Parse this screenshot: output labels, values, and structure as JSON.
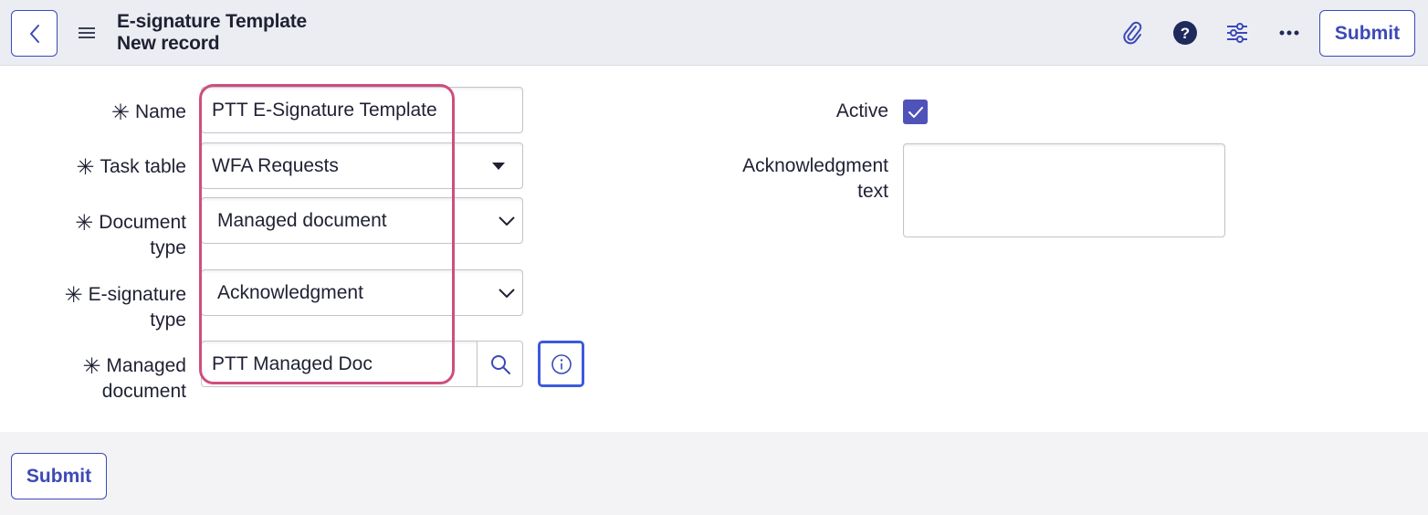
{
  "header": {
    "title_line1": "E-signature Template",
    "title_line2": "New record",
    "submit_label": "Submit",
    "icons": [
      "chevron-left-icon",
      "hamburger-menu-icon",
      "paperclip-icon",
      "help-icon",
      "sliders-icon",
      "more-options-icon"
    ]
  },
  "form": {
    "name": {
      "label": "Name",
      "value": "PTT E-Signature Template",
      "required": true
    },
    "task_table": {
      "label": "Task table",
      "value": "WFA Requests",
      "required": true
    },
    "document_type": {
      "label_line1": "Document",
      "label_line2": "type",
      "value": "Managed document",
      "required": true
    },
    "esignature_type": {
      "label_line1": "E-signature",
      "label_line2": "type",
      "value": "Acknowledgment",
      "required": true
    },
    "managed_document": {
      "label_line1": "Managed",
      "label_line2": "document",
      "value": "PTT Managed Doc",
      "required": true
    },
    "active": {
      "label": "Active",
      "checked": true
    },
    "acknowledgment_text": {
      "label_line1": "Acknowledgment",
      "label_line2": "text",
      "value": ""
    },
    "required_marker": "✳"
  },
  "footer": {
    "submit_label": "Submit"
  },
  "colors": {
    "accent": "#3b49b8",
    "highlight": "#cf4e7e",
    "checkbox": "#4f52b8",
    "header_bg": "#ecedf2"
  }
}
